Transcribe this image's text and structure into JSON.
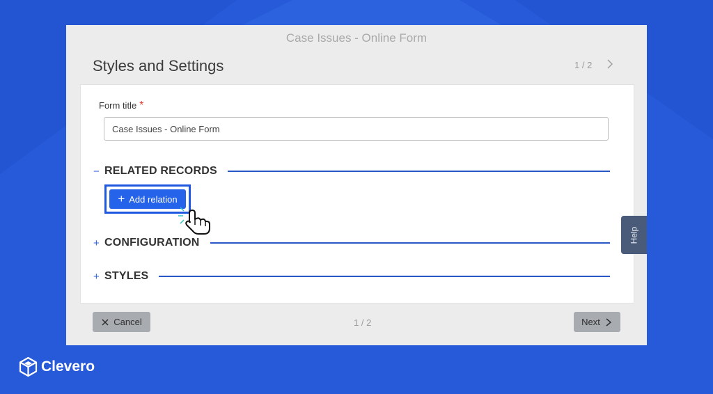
{
  "window_title": "Case Issues - Online Form",
  "heading": "Styles and Settings",
  "pager_top": "1 / 2",
  "form": {
    "title_label": "Form title",
    "required_mark": "*",
    "title_value": "Case Issues - Online Form"
  },
  "sections": {
    "related": {
      "toggle": "−",
      "label": "RELATED RECORDS"
    },
    "configuration": {
      "toggle": "+",
      "label": "CONFIGURATION"
    },
    "styles": {
      "toggle": "+",
      "label": "STYLES"
    }
  },
  "add_relation": {
    "label": "Add relation"
  },
  "footer": {
    "cancel": "Cancel",
    "pager": "1 / 2",
    "next": "Next"
  },
  "help_tab": "Help",
  "brand": {
    "name": "Clevero"
  },
  "colors": {
    "background": "#2354d1",
    "accent": "#2563eb",
    "section_line": "#2a57c8",
    "required": "#e53935"
  }
}
